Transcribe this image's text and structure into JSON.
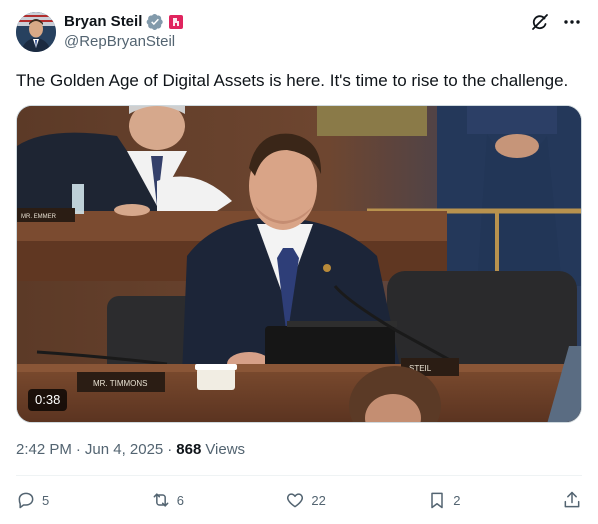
{
  "author": {
    "display_name": "Bryan Steil",
    "handle": "@RepBryanSteil",
    "verified_color": "#829aab",
    "affiliation_color": "#e0245e"
  },
  "tweet": {
    "text": "The Golden Age of Digital Assets is here. It's time to rise to the challenge."
  },
  "media": {
    "duration": "0:38",
    "nameplates": [
      "MR. EMMER",
      "MR. TIMMONS",
      "STEIL"
    ]
  },
  "meta": {
    "time": "2:42 PM",
    "sep1": "·",
    "date": "Jun 4, 2025",
    "sep2": "·",
    "views_count": "868",
    "views_label": "Views"
  },
  "actions": {
    "replies": "5",
    "reposts": "6",
    "likes": "22",
    "bookmarks": "2"
  },
  "colors": {
    "text_primary": "#0f1419",
    "text_secondary": "#536471",
    "border": "#cfd9de"
  },
  "icons": [
    "grok-icon",
    "more-icon",
    "reply-icon",
    "repost-icon",
    "like-icon",
    "bookmark-icon",
    "share-icon"
  ]
}
